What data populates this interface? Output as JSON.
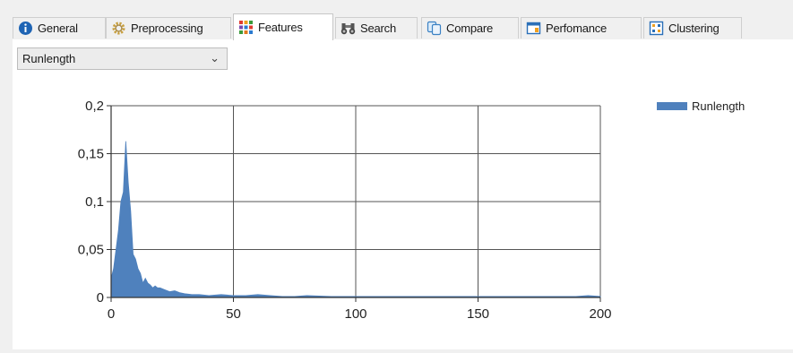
{
  "tabs": [
    {
      "label": "General",
      "icon": "info-icon",
      "active": false
    },
    {
      "label": "Preprocessing",
      "icon": "gear-icon",
      "active": false
    },
    {
      "label": "Features",
      "icon": "grid-icon",
      "active": true
    },
    {
      "label": "Search",
      "icon": "binoculars-icon",
      "active": false
    },
    {
      "label": "Compare",
      "icon": "compare-icon",
      "active": false
    },
    {
      "label": "Perfomance",
      "icon": "window-icon",
      "active": false
    },
    {
      "label": "Clustering",
      "icon": "cluster-icon",
      "active": false
    }
  ],
  "feature_select": {
    "value": "Runlength"
  },
  "colors": {
    "series": "#4f81bd",
    "grid": "#555555",
    "axis": "#333333"
  },
  "chart_data": {
    "type": "area",
    "title": "",
    "xlabel": "",
    "ylabel": "",
    "xlim": [
      0,
      200
    ],
    "ylim": [
      0,
      0.2
    ],
    "xticks": [
      "0",
      "50",
      "100",
      "150",
      "200"
    ],
    "yticks": [
      "0",
      "0,05",
      "0,1",
      "0,15",
      "0,2"
    ],
    "grid": true,
    "legend_position": "top-right",
    "series": [
      {
        "name": "Runlength",
        "x": [
          0,
          1,
          2,
          3,
          4,
          5,
          6,
          7,
          8,
          9,
          10,
          11,
          12,
          13,
          14,
          15,
          16,
          17,
          18,
          19,
          20,
          22,
          24,
          26,
          28,
          30,
          33,
          36,
          40,
          45,
          50,
          55,
          60,
          65,
          70,
          75,
          80,
          90,
          100,
          110,
          120,
          130,
          140,
          150,
          160,
          170,
          180,
          190,
          195,
          200
        ],
        "values": [
          0.02,
          0.03,
          0.05,
          0.07,
          0.1,
          0.11,
          0.163,
          0.12,
          0.09,
          0.045,
          0.04,
          0.03,
          0.025,
          0.015,
          0.02,
          0.015,
          0.013,
          0.01,
          0.012,
          0.01,
          0.01,
          0.008,
          0.006,
          0.007,
          0.005,
          0.004,
          0.003,
          0.003,
          0.002,
          0.003,
          0.002,
          0.002,
          0.003,
          0.002,
          0.001,
          0.001,
          0.002,
          0.001,
          0.001,
          0.001,
          0.001,
          0.001,
          0.001,
          0.001,
          0.001,
          0.001,
          0.001,
          0.001,
          0.002,
          0.001
        ]
      }
    ]
  }
}
